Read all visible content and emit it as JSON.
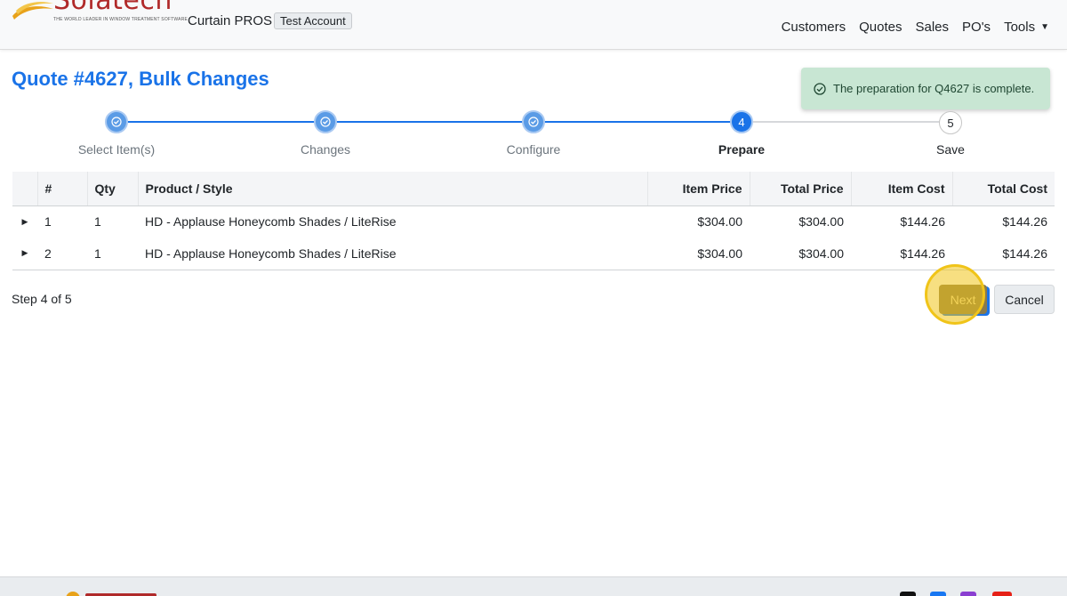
{
  "header": {
    "logo_text": "Solatech",
    "logo_tagline": "THE WORLD LEADER IN WINDOW TREATMENT SOFTWARE",
    "company": "Curtain PROS",
    "account_badge": "Test Account",
    "nav": [
      "Customers",
      "Quotes",
      "Sales",
      "PO's",
      "Tools"
    ]
  },
  "page": {
    "title": "Quote #4627, Bulk Changes"
  },
  "toast": {
    "message": "The preparation for Q4627 is complete."
  },
  "stepper": {
    "steps": [
      {
        "label": "Select Item(s)",
        "state": "done"
      },
      {
        "label": "Changes",
        "state": "done"
      },
      {
        "label": "Configure",
        "state": "done"
      },
      {
        "label": "Prepare",
        "number": "4",
        "state": "active"
      },
      {
        "label": "Save",
        "number": "5",
        "state": "pending"
      }
    ]
  },
  "table": {
    "headers": [
      "#",
      "Qty",
      "Product / Style",
      "Item Price",
      "Total Price",
      "Item Cost",
      "Total Cost"
    ],
    "rows": [
      {
        "num": "1",
        "qty": "1",
        "product": "HD - Applause Honeycomb Shades / LiteRise",
        "item_price": "$304.00",
        "total_price": "$304.00",
        "item_cost": "$144.26",
        "total_cost": "$144.26"
      },
      {
        "num": "2",
        "qty": "1",
        "product": "HD - Applause Honeycomb Shades / LiteRise",
        "item_price": "$304.00",
        "total_price": "$304.00",
        "item_cost": "$144.26",
        "total_cost": "$144.26"
      }
    ]
  },
  "footer": {
    "step_count": "Step 4 of 5",
    "next_label": "Next",
    "cancel_label": "Cancel"
  },
  "colors": {
    "accent": "#1a73e8",
    "toast_bg": "#c8e6d3",
    "highlight": "#f0c419"
  },
  "icons": {
    "toast": "check-circle-icon",
    "step_done": "check-icon",
    "row_expand": "caret-right-icon",
    "tools": "caret-down-icon"
  }
}
